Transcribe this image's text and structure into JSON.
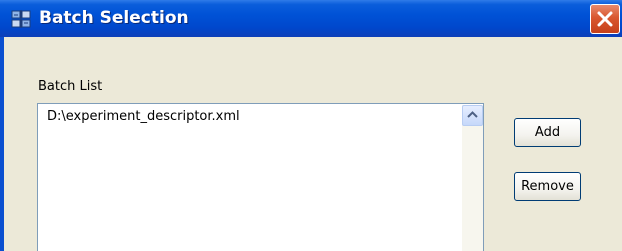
{
  "window": {
    "title": "Batch Selection",
    "icon": "app-icon",
    "close_icon": "close-icon"
  },
  "batch_list": {
    "label": "Batch List",
    "items": [
      "D:\\experiment_descriptor.xml"
    ],
    "scroll_up_icon": "chevron-up-icon"
  },
  "buttons": {
    "add_label": "Add",
    "remove_label": "Remove"
  },
  "colors": {
    "titlebar": "#0052d6",
    "close_button": "#d9572f",
    "dialog_background": "#ece9d8"
  }
}
